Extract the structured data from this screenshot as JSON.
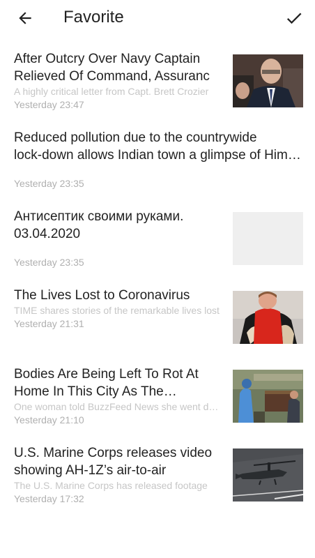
{
  "header": {
    "title": "Favorite",
    "back_icon": "arrow-left-icon",
    "done_icon": "check-icon"
  },
  "items": [
    {
      "headline": "After Outcry Over Navy Captain Relieved Of Command, Assuranc",
      "description": "A highly critical letter from Capt. Brett Crozier",
      "time": "Yesterday 23:47"
    },
    {
      "headline_line1": "Reduced pollution due to the countrywide",
      "headline_line2": "lock-down allows Indian town a glimpse of Himalayas",
      "description": "",
      "time": "Yesterday 23:35"
    },
    {
      "headline": "Антисептик своими руками. 03.04.2020",
      "description": "",
      "time": "Yesterday 23:35"
    },
    {
      "headline": "The Lives Lost to Coronavirus",
      "description": "TIME shares stories of the remarkable lives lost",
      "time": "Yesterday 21:31"
    },
    {
      "headline": "Bodies Are Being Left To Rot At Home In This City As The Coronavirus",
      "description": "One woman told BuzzFeed News she went days",
      "time": "Yesterday 21:10"
    },
    {
      "headline": "U.S. Marine Corps releases video showing AH-1Z’s air-to-air",
      "description": "The U.S. Marine Corps has released footage",
      "time": "Yesterday 17:32"
    }
  ]
}
